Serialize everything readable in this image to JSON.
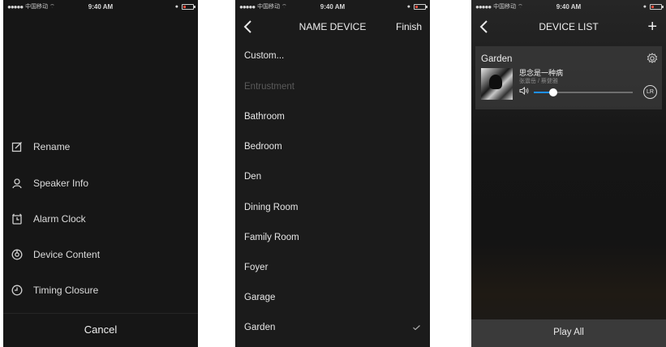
{
  "status": {
    "carrier": "中国移动",
    "time": "9:40 AM"
  },
  "panel1": {
    "menu": [
      {
        "label": "Rename",
        "icon": "edit-icon"
      },
      {
        "label": "Speaker Info",
        "icon": "person-icon"
      },
      {
        "label": "Alarm Clock",
        "icon": "alarm-clock-icon"
      },
      {
        "label": "Device Content",
        "icon": "content-icon"
      },
      {
        "label": "Timing Closure",
        "icon": "timer-icon"
      }
    ],
    "cancel": "Cancel"
  },
  "panel2": {
    "title": "NAME DEVICE",
    "finish": "Finish",
    "rooms": [
      "Custom...",
      "Entrustment",
      "Bathroom",
      "Bedroom",
      "Den",
      "Dining Room",
      "Family Room",
      "Foyer",
      "Garage",
      "Garden"
    ],
    "selected": "Garden"
  },
  "panel3": {
    "title": "DEVICE LIST",
    "zone": "Garden",
    "track": "思念是一种病",
    "artist": "张震岳 / 蔡健雅",
    "channel": "LR",
    "volume": 0.2,
    "play_all": "Play All",
    "colors": {
      "volume_accent": "#1e90ff"
    }
  }
}
